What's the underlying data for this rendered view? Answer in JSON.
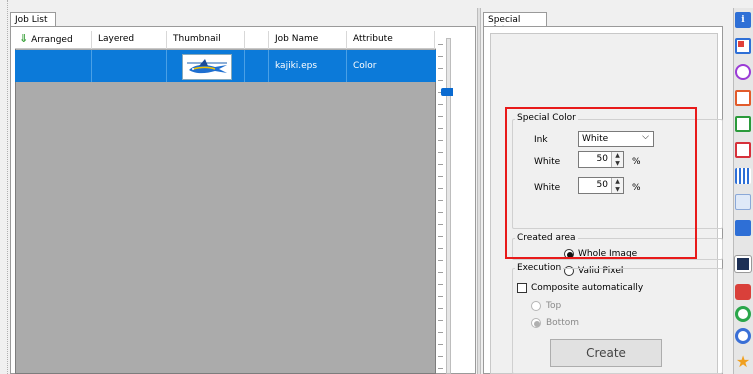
{
  "job_list": {
    "tab_label": "Job List",
    "columns": [
      "Arranged",
      "Layered",
      "Thumbnail",
      "Job Name",
      "Attribute"
    ],
    "rows": [
      {
        "arranged": "",
        "layered": "",
        "thumbnail": "marlin-thumbnail",
        "job_name": "kajiki.eps",
        "attribute": "Color"
      }
    ]
  },
  "special_plate": {
    "tab_label": "Special plate",
    "special_color": {
      "title": "Special Color",
      "ink_label": "Ink",
      "ink_value": "White",
      "row1_label": "White",
      "row1_value": "50",
      "row2_label": "White",
      "row2_value": "50",
      "unit": "%"
    },
    "created_area": {
      "title": "Created area",
      "options": [
        "Whole Image",
        "Valid Pixel"
      ],
      "selected": "Whole Image"
    },
    "execution": {
      "title": "Execution",
      "composite_label": "Composite automatically",
      "composite_checked": false,
      "position_options": [
        "Top",
        "Bottom"
      ],
      "position_selected": "Bottom",
      "create_label": "Create"
    }
  },
  "colors": {
    "selection": "#0c7ad9",
    "highlight_frame": "#e81a1a",
    "grid_background": "#ababab"
  },
  "toolbar_icons": [
    "info-icon",
    "layout-icon",
    "rotate-icon",
    "crop-icon",
    "frame-icon",
    "split-icon",
    "grid-icon",
    "copy-icon",
    "composite-icon",
    "special-plate-icon",
    "mask-icon",
    "recycle-icon",
    "color-target-icon",
    "star-icon"
  ]
}
